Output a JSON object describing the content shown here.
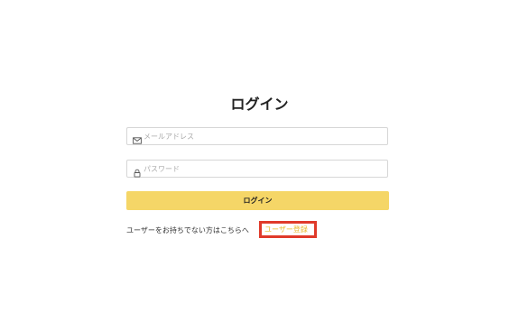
{
  "page": {
    "title": "ログイン"
  },
  "form": {
    "email": {
      "placeholder": "メールアドレス",
      "value": "",
      "icon": "mail-icon"
    },
    "password": {
      "placeholder": "パスワード",
      "value": "",
      "icon": "lock-icon"
    },
    "submit_label": "ログイン"
  },
  "register": {
    "prompt": "ユーザーをお持ちでない方はこちらへ",
    "link_label": "ユーザー登録"
  },
  "colors": {
    "button_background": "#f5d667",
    "link": "#e8b82a",
    "highlight_border": "#e03a2a"
  }
}
